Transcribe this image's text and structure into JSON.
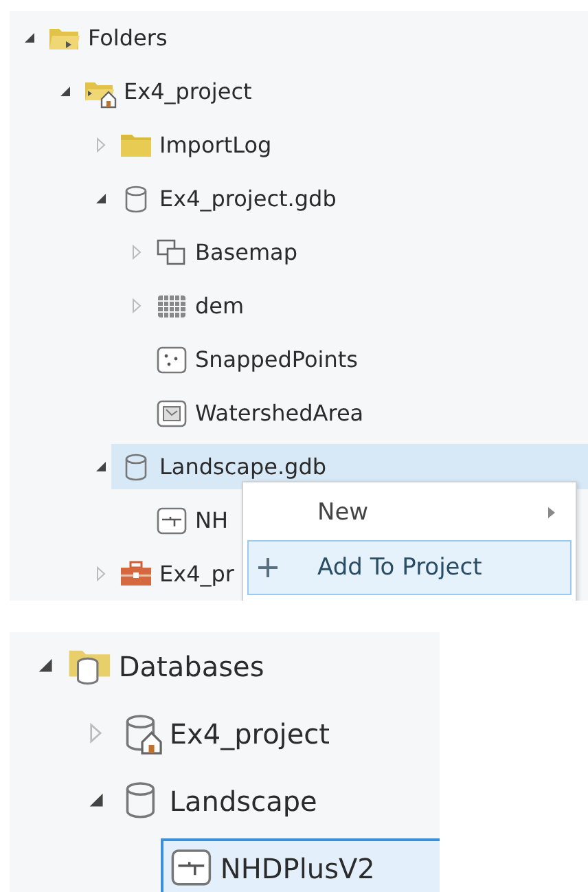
{
  "catalog_tree": [
    {
      "label": "Folders",
      "kind": "folder-open",
      "expanded": true,
      "selected": false,
      "children": [
        {
          "label": "Ex4_project",
          "kind": "home-folder",
          "expanded": true,
          "selected": false,
          "children": [
            {
              "label": "ImportLog",
              "kind": "folder",
              "expanded": false,
              "selected": false
            },
            {
              "label": "Ex4_project.gdb",
              "kind": "geodatabase",
              "expanded": true,
              "selected": false,
              "children": [
                {
                  "label": "Basemap",
                  "kind": "feature-dataset",
                  "expanded": false,
                  "selected": false
                },
                {
                  "label": "dem",
                  "kind": "raster",
                  "expanded": false,
                  "selected": false
                },
                {
                  "label": "SnappedPoints",
                  "kind": "point-class",
                  "selected": false
                },
                {
                  "label": "WatershedArea",
                  "kind": "polygon-class",
                  "selected": false
                }
              ]
            },
            {
              "label": "Landscape.gdb",
              "kind": "geodatabase",
              "expanded": true,
              "selected": true,
              "children": [
                {
                  "label": "NH",
                  "kind": "line-class",
                  "selected": false
                }
              ]
            },
            {
              "label": "Ex4_pr",
              "kind": "toolbox",
              "expanded": false,
              "selected": false
            }
          ]
        }
      ]
    }
  ],
  "context_menu": [
    {
      "label": "New",
      "kind": "submenu",
      "selected": false
    },
    {
      "label": "Add To Project",
      "kind": "add",
      "selected": true
    }
  ],
  "databases_tree": [
    {
      "label": "Databases",
      "kind": "database-folder",
      "expanded": true,
      "selected": false,
      "children": [
        {
          "label": "Ex4_project",
          "kind": "home-database",
          "expanded": false,
          "selected": false
        },
        {
          "label": "Landscape",
          "kind": "geodatabase",
          "expanded": true,
          "selected": false,
          "children": [
            {
              "label": "NHDPlusV2",
              "kind": "line-class",
              "selected": true
            }
          ]
        }
      ]
    }
  ]
}
